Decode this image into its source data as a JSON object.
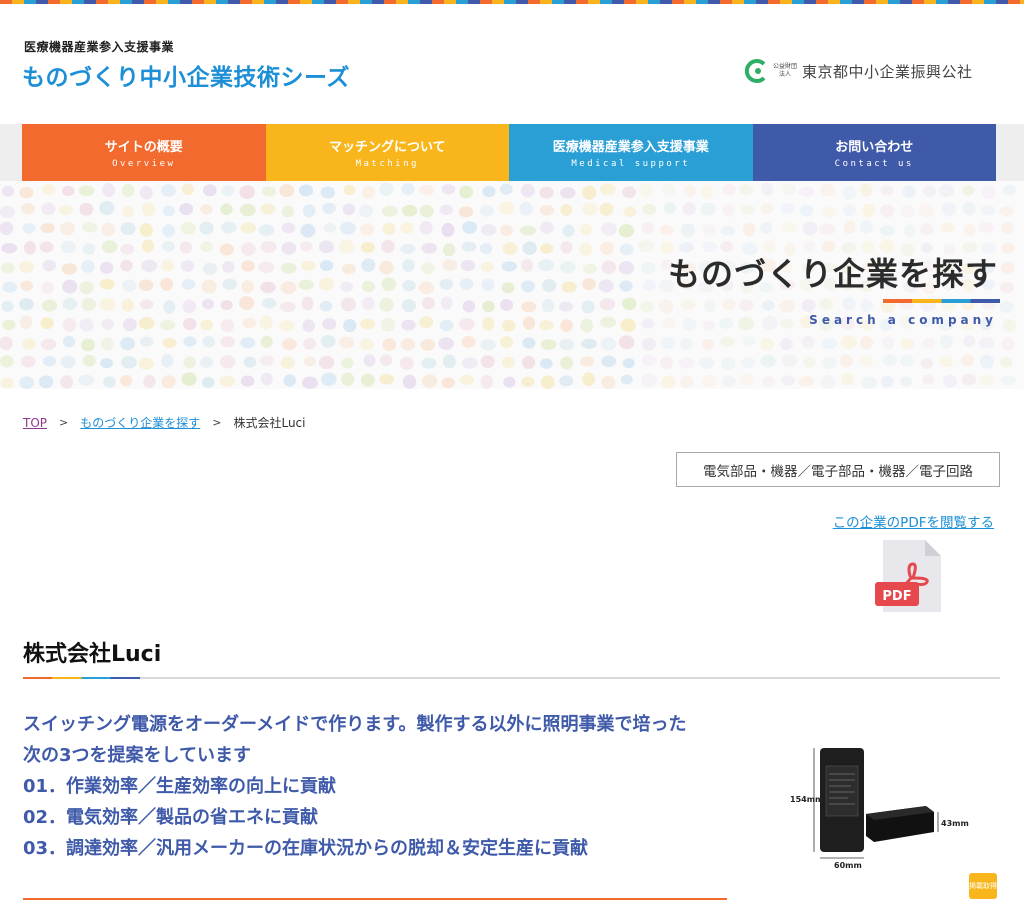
{
  "header": {
    "subtitle": "医療機器産業参入支援事業",
    "title": "ものづくり中小企業技術シーズ",
    "corp_prefix": "公益財団法人",
    "corp_name": "東京都中小企業振興公社"
  },
  "nav": [
    {
      "jp": "サイトの概要",
      "en": "Overview",
      "color": "#f26a2d"
    },
    {
      "jp": "マッチングについて",
      "en": "Matching",
      "color": "#f8b61c"
    },
    {
      "jp": "医療機器産業参入支援事業",
      "en": "Medical support",
      "color": "#2a9fd6"
    },
    {
      "jp": "お問い合わせ",
      "en": "Contact us",
      "color": "#3f5aa9"
    }
  ],
  "hero": {
    "title": "ものづくり企業を探す",
    "subtitle_en": "Search a company"
  },
  "breadcrumb": {
    "top": "TOP",
    "search": "ものづくり企業を探す",
    "current": "株式会社Luci"
  },
  "category": "電気部品・機器／電子部品・機器／電子回路",
  "pdf": {
    "link": "この企業のPDFを閲覧する",
    "icon_label": "PDF"
  },
  "company": {
    "name": "株式会社Luci",
    "description": [
      "スイッチング電源をオーダーメイドで作ります。製作する以外に照明事業で培った",
      "次の3つを提案をしています",
      "01．作業効率／生産効率の向上に貢献",
      "02．電気効率／製品の省エネに貢献",
      "03．調達効率／汎用メーカーの在庫状況からの脱却＆安定生産に貢献"
    ]
  },
  "product_image": {
    "dim_height": "154mm",
    "dim_depth": "43mm",
    "dim_width": "60mm"
  },
  "badge": "掲載取得"
}
